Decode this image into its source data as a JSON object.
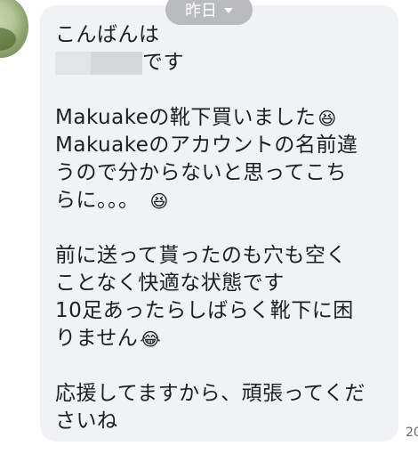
{
  "date_pill": {
    "label": "昨日"
  },
  "message": {
    "greeting": "こんばんは",
    "name_suffix": "です",
    "line_purchase": "Makuakeの靴下買いました",
    "emoji_purchase": "😆",
    "line_account_1": "Makuakeのアカウントの名前違",
    "line_account_2": "うので分からないと思ってこち",
    "line_account_3": "らに。。。",
    "emoji_account": "😆",
    "line_socks_1": "前に送って貰ったのも穴も空く",
    "line_socks_2": "ことなく快適な状態です",
    "line_socks_3": "10足あったらしばらく靴下に困",
    "line_socks_4": "りません",
    "emoji_socks": "😂",
    "line_cheer_1": "応援してますから、頑張ってくだ",
    "line_cheer_2": "さいね"
  },
  "timestamp_partial": "20"
}
